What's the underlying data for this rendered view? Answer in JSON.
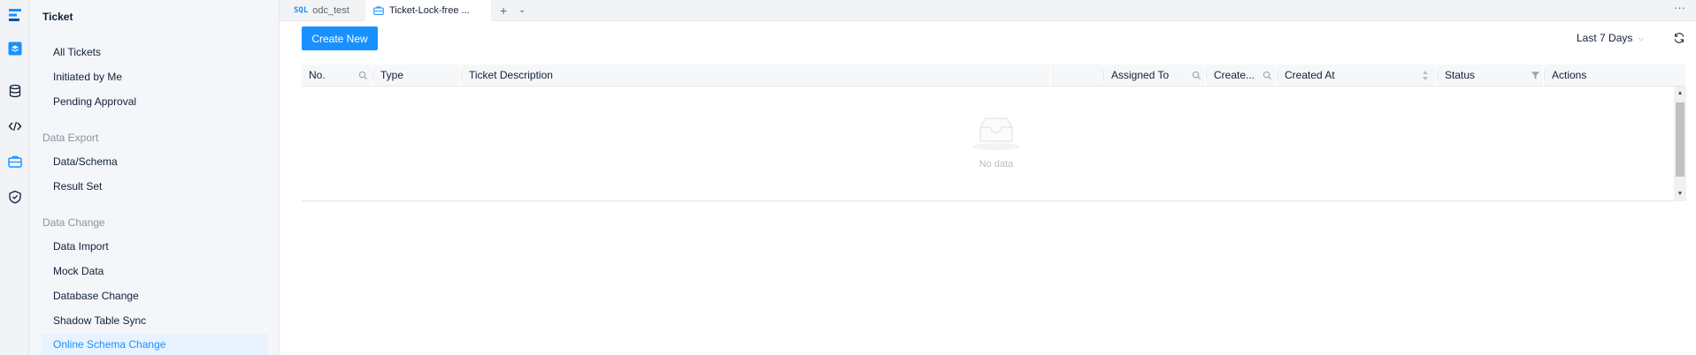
{
  "rail": {
    "icons": [
      "logo-icon",
      "project-icon",
      "database-icon",
      "code-icon",
      "ticket-icon",
      "security-icon"
    ]
  },
  "sidebar": {
    "title": "Ticket",
    "items": [
      {
        "label": "All Tickets"
      },
      {
        "label": "Initiated by Me"
      },
      {
        "label": "Pending Approval"
      }
    ],
    "groups": [
      {
        "label": "Data Export",
        "items": [
          {
            "label": "Data/Schema"
          },
          {
            "label": "Result Set"
          }
        ]
      },
      {
        "label": "Data Change",
        "items": [
          {
            "label": "Data Import"
          },
          {
            "label": "Mock Data"
          },
          {
            "label": "Database Change"
          },
          {
            "label": "Shadow Table Sync"
          },
          {
            "label": "Online Schema Change"
          }
        ]
      }
    ],
    "active": "Online Schema Change"
  },
  "tabs": [
    {
      "icon": "SQL",
      "label": "odc_test",
      "active": false
    },
    {
      "icon": "ticket-icon",
      "label": "Ticket-Lock-free ...",
      "active": true
    }
  ],
  "toolbar": {
    "create_label": "Create New",
    "range_label": "Last 7 Days",
    "more_label": "···"
  },
  "table": {
    "columns": [
      {
        "label": "No.",
        "icon": "search-icon"
      },
      {
        "label": "Type"
      },
      {
        "label": "Ticket Description"
      },
      {
        "label": "Assigned To",
        "icon": "search-icon"
      },
      {
        "label": "Create...",
        "icon": "search-icon"
      },
      {
        "label": "Created At",
        "icon": "sort-icon"
      },
      {
        "label": "Status",
        "icon": "filter-icon"
      },
      {
        "label": "Actions"
      }
    ],
    "rows": [],
    "empty_text": "No data"
  },
  "colors": {
    "accent": "#1890ff",
    "active_bg": "#e8f3ff",
    "sidebar_bg": "#f4f6f9",
    "header_bg": "#f6f7f9"
  }
}
